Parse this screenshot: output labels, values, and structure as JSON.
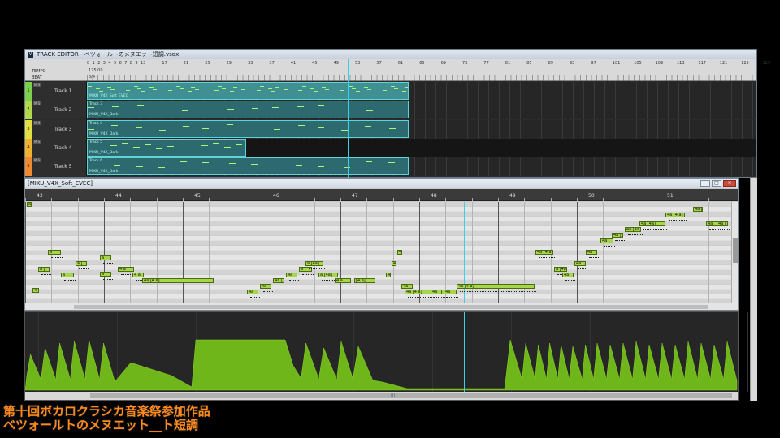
{
  "track_editor": {
    "title": "TRACK EDITOR - ベツォールトのメヌエット短調.vsqx",
    "app_icon": "V",
    "tempo_label": "TEMPO",
    "beat_label": "BEAT",
    "tempo_value": "125.00",
    "beat_value": "3/4",
    "ruler": [
      "0",
      "1",
      "2",
      "3",
      "4",
      "5",
      "6",
      "7",
      "8",
      "9",
      "13",
      "17",
      "21",
      "25",
      "29",
      "33",
      "37",
      "41",
      "45",
      "49",
      "53",
      "57",
      "61",
      "65",
      "69",
      "73",
      "77",
      "81",
      "85",
      "89",
      "93",
      "97",
      "101",
      "105",
      "109",
      "113",
      "117",
      "121",
      "125",
      "129",
      "133"
    ],
    "tracks": [
      {
        "num": "1",
        "name": "Track 1",
        "color": "#7ad04a",
        "ms": "M S",
        "part_label": "MIKU_V4X_Soft_EVEC"
      },
      {
        "num": "2",
        "name": "Track 2",
        "color": "#b0d84a",
        "ms": "M S",
        "part_title": "Track 3",
        "part_label": "MIKU_V4X_Dark"
      },
      {
        "num": "3",
        "name": "Track 3",
        "color": "#e0e040",
        "ms": "M S",
        "part_title": "Track 4",
        "part_label": "MIKU_V4X_Dark"
      },
      {
        "num": "4",
        "name": "Track 4",
        "color": "#f0b030",
        "ms": "M S",
        "part_title": "Track 5",
        "part_label": "MIKU_V4X_Dark"
      },
      {
        "num": "5",
        "name": "Track 5",
        "color": "#f08a30",
        "ms": "M S",
        "part_title": "Track 6",
        "part_label": "MIKU_V4X_Dark"
      }
    ]
  },
  "piano_roll": {
    "title": "[MIKU_V4X_Soft_EVEC]",
    "bars": [
      "43",
      "44",
      "45",
      "46",
      "47",
      "48",
      "49",
      "50",
      "51"
    ],
    "notes": [
      {
        "t": "4",
        "l": 9,
        "r": 106,
        "w": 8
      },
      {
        "t": "a",
        "l": 2,
        "r": 0,
        "w": 6
      },
      {
        "t": "a [",
        "l": 28,
        "r": 59,
        "w": 16
      },
      {
        "t": "a [",
        "l": 62,
        "r": 73,
        "w": 14
      },
      {
        "t": "a [",
        "l": 92,
        "r": 66,
        "w": 14
      },
      {
        "t": "a [",
        "l": 16,
        "r": 80,
        "w": 14
      },
      {
        "t": "a [",
        "l": 44,
        "r": 87,
        "w": 16
      },
      {
        "t": "a [",
        "l": 92,
        "r": 86,
        "w": 14
      },
      {
        "t": "4 a",
        "l": 114,
        "r": 80,
        "w": 20
      },
      {
        "t": "4 a",
        "l": 132,
        "r": 87,
        "w": 14
      },
      {
        "t": "4a [4 a]",
        "l": 144,
        "r": 94,
        "w": 88
      },
      {
        "t": "4a",
        "l": 273,
        "r": 108,
        "w": 14
      },
      {
        "t": "4a",
        "l": 289,
        "r": 101,
        "w": 14
      },
      {
        "t": "4a [",
        "l": 305,
        "r": 94,
        "w": 14
      },
      {
        "t": "4a",
        "l": 321,
        "r": 87,
        "w": 14
      },
      {
        "t": "a [",
        "l": 337,
        "r": 80,
        "w": 16
      },
      {
        "t": "a [4a]",
        "l": 345,
        "r": 73,
        "w": 22
      },
      {
        "t": "a [4a]",
        "l": 361,
        "r": 87,
        "w": 24
      },
      {
        "t": "4 a",
        "l": 381,
        "r": 94,
        "w": 20
      },
      {
        "t": "[4 a]",
        "l": 405,
        "r": 94,
        "w": 26
      },
      {
        "t": "4",
        "l": 451,
        "r": 73,
        "w": 6
      },
      {
        "t": "4",
        "l": 458,
        "r": 59,
        "w": 6
      },
      {
        "t": "4",
        "l": 444,
        "r": 87,
        "w": 6
      },
      {
        "t": "4a",
        "l": 463,
        "r": 101,
        "w": 14
      },
      {
        "t": "4a [4 a]",
        "l": 467,
        "r": 108,
        "w": 50
      },
      {
        "t": "4a",
        "l": 499,
        "r": 108,
        "w": 14
      },
      {
        "t": "4a",
        "l": 515,
        "r": 108,
        "w": 16
      },
      {
        "t": "4a [4 a]",
        "l": 531,
        "r": 101,
        "w": 96
      },
      {
        "t": "4a [4 a]",
        "l": 628,
        "r": 59,
        "w": 22
      },
      {
        "t": "a [4a]",
        "l": 651,
        "r": 80,
        "w": 16
      },
      {
        "t": "4a",
        "l": 661,
        "r": 87,
        "w": 14
      },
      {
        "t": "4a",
        "l": 676,
        "r": 73,
        "w": 14
      },
      {
        "t": "4a",
        "l": 690,
        "r": 59,
        "w": 14
      },
      {
        "t": "4a [",
        "l": 708,
        "r": 45,
        "w": 16
      },
      {
        "t": "4a [",
        "l": 722,
        "r": 38,
        "w": 14
      },
      {
        "t": "4a [4a]",
        "l": 738,
        "r": 31,
        "w": 20
      },
      {
        "t": "4a [4a]",
        "l": 756,
        "r": 24,
        "w": 32
      },
      {
        "t": "4a [4 a]",
        "l": 788,
        "r": 13,
        "w": 24
      },
      {
        "t": "4a [",
        "l": 822,
        "r": 6,
        "w": 12
      },
      {
        "t": "4a",
        "l": 838,
        "r": 24,
        "w": 14
      },
      {
        "t": "4a [",
        "l": 851,
        "r": 24,
        "w": 14
      },
      {
        "t": "4a",
        "l": 874,
        "r": 13,
        "w": 14
      },
      {
        "t": "4a",
        "l": 886,
        "r": 6,
        "w": 12
      }
    ]
  },
  "dynamics": {
    "scroll_grip": "|||"
  },
  "caption": {
    "line1": "第十回ボカロクラシカ音楽祭参加作品",
    "line2": "ベツォールトのメヌエット__ト短調"
  }
}
